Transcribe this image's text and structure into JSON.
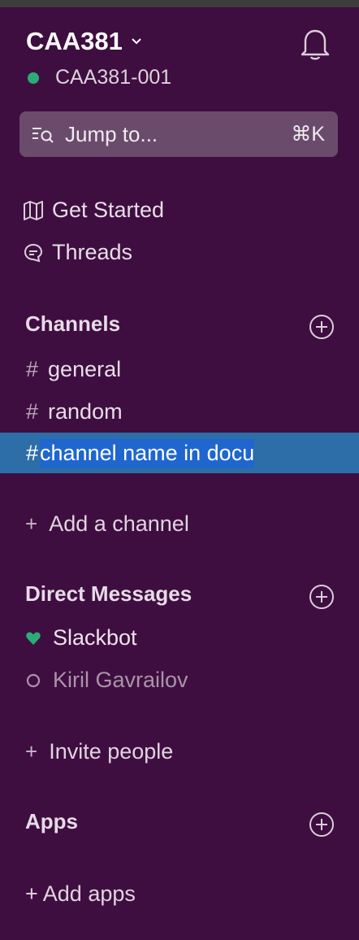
{
  "workspace": {
    "name": "CAA381",
    "user": "CAA381-001",
    "status_color": "#2bac76"
  },
  "jump": {
    "label": "Jump to...",
    "shortcut": "⌘K"
  },
  "nav": [
    {
      "label": "Get Started",
      "icon": "map-icon"
    },
    {
      "label": "Threads",
      "icon": "threads-icon"
    }
  ],
  "channels": {
    "title": "Channels",
    "items": [
      {
        "name": "general"
      },
      {
        "name": "random"
      },
      {
        "name": "channel name in docu",
        "editing": true
      }
    ],
    "add_label": "Add a channel"
  },
  "dms": {
    "title": "Direct Messages",
    "items": [
      {
        "name": "Slackbot",
        "status": "heart"
      },
      {
        "name": "Kiril Gavrailov",
        "status": "away"
      }
    ],
    "invite_label": "Invite people"
  },
  "apps": {
    "title": "Apps",
    "add_label": "+ Add apps"
  },
  "colors": {
    "sidebar": "#3f0e40",
    "active": "#2d6ea8",
    "selection": "#1f66cf"
  }
}
